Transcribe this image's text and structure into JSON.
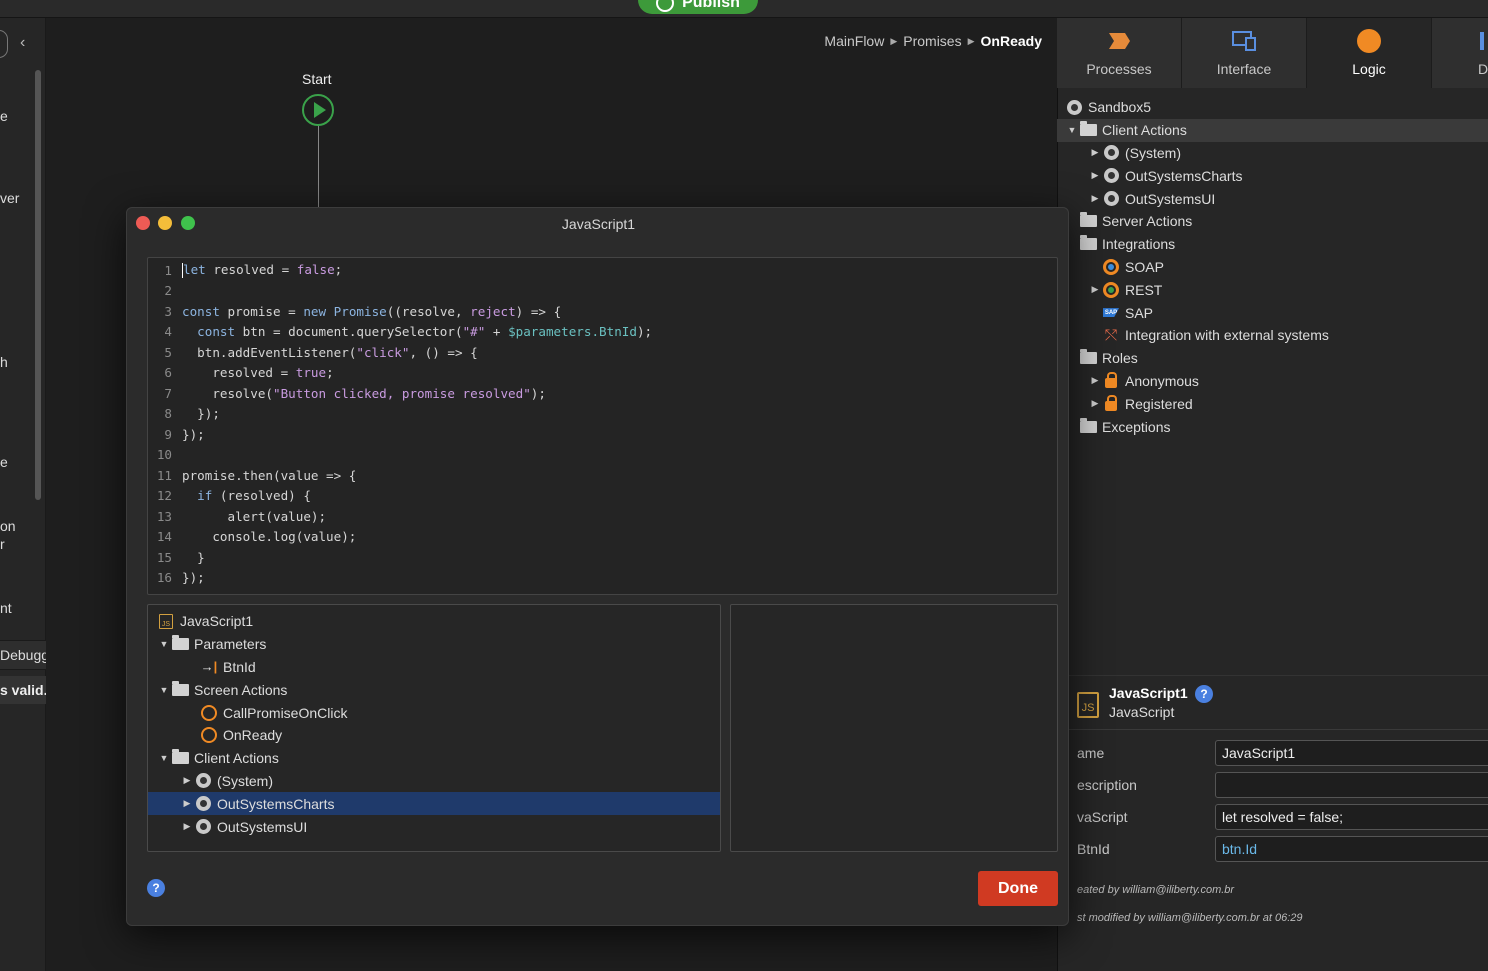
{
  "toolbar": {
    "publish_label": "Publish"
  },
  "left_panel": {
    "fragments": [
      "e",
      "ver",
      "h",
      "e",
      "on",
      "r",
      "nt"
    ],
    "debugger_label": "Debugger",
    "valid_text": "s valid."
  },
  "canvas": {
    "breadcrumb": [
      "MainFlow",
      "Promises",
      "OnReady"
    ],
    "start_label": "Start"
  },
  "right_panel": {
    "tabs": [
      {
        "label": "Processes",
        "icon": "processes-icon"
      },
      {
        "label": "Interface",
        "icon": "interface-icon"
      },
      {
        "label": "Logic",
        "icon": "logic-icon"
      },
      {
        "label": "D",
        "icon": "data-icon"
      }
    ],
    "tree": [
      {
        "label": "Sandbox5",
        "icon": "module-icon"
      },
      {
        "label": "Client Actions",
        "icon": "folder-open-icon",
        "caret": "down"
      },
      {
        "label": "(System)",
        "icon": "module-icon",
        "caret": "right"
      },
      {
        "label": "OutSystemsCharts",
        "icon": "module-icon",
        "caret": "right"
      },
      {
        "label": "OutSystemsUI",
        "icon": "module-icon",
        "caret": "right"
      },
      {
        "label": "Server Actions",
        "icon": "folder-icon"
      },
      {
        "label": "Integrations",
        "icon": "folder-open-icon"
      },
      {
        "label": "SOAP",
        "icon": "soap-icon"
      },
      {
        "label": "REST",
        "icon": "rest-icon",
        "caret": "right"
      },
      {
        "label": "SAP",
        "icon": "sap-icon"
      },
      {
        "label": "Integration with external systems",
        "icon": "integration-icon"
      },
      {
        "label": "Roles",
        "icon": "folder-open-icon"
      },
      {
        "label": "Anonymous",
        "icon": "lock-icon",
        "caret": "right"
      },
      {
        "label": "Registered",
        "icon": "lock-icon",
        "caret": "right"
      },
      {
        "label": "Exceptions",
        "icon": "folder-icon"
      }
    ],
    "properties": {
      "title": "JavaScript1",
      "subtitle": "JavaScript",
      "js_icon_text": "JS",
      "fields": [
        {
          "label": "ame",
          "value": "JavaScript1"
        },
        {
          "label": "escription",
          "value": ""
        },
        {
          "label": "vaScript",
          "value": "let resolved = false;"
        },
        {
          "label": "BtnId",
          "value": "btn.Id"
        }
      ],
      "created_by": "eated by william@iliberty.com.br",
      "modified_by": "st modified by william@iliberty.com.br at 06:29"
    }
  },
  "modal": {
    "title": "JavaScript1",
    "code_lines": [
      "let resolved = false;",
      "",
      "const promise = new Promise((resolve, reject) => {",
      "  const btn = document.querySelector(\"#\" + $parameters.BtnId);",
      "  btn.addEventListener(\"click\", () => {",
      "    resolved = true;",
      "    resolve(\"Button clicked, promise resolved\");",
      "  });",
      "});",
      "",
      "promise.then(value => {",
      "  if (resolved) {",
      "      alert(value);",
      "    console.log(value);",
      "  }",
      "});"
    ],
    "tree": [
      {
        "label": "JavaScript1",
        "icon": "js-icon",
        "indent": 0
      },
      {
        "label": "Parameters",
        "icon": "folder-open-icon",
        "indent": 0,
        "caret": "down"
      },
      {
        "label": "BtnId",
        "icon": "input-parameter-icon",
        "indent": 1
      },
      {
        "label": "Screen Actions",
        "icon": "folder-open-icon",
        "indent": 0,
        "caret": "down"
      },
      {
        "label": "CallPromiseOnClick",
        "icon": "action-icon",
        "indent": 1
      },
      {
        "label": "OnReady",
        "icon": "action-icon",
        "indent": 1
      },
      {
        "label": "Client Actions",
        "icon": "folder-open-icon",
        "indent": 0,
        "caret": "down"
      },
      {
        "label": "(System)",
        "icon": "module-icon",
        "indent": 1,
        "caret": "right"
      },
      {
        "label": "OutSystemsCharts",
        "icon": "module-icon",
        "indent": 1,
        "caret": "right",
        "selected": true
      },
      {
        "label": "OutSystemsUI",
        "icon": "module-icon",
        "indent": 1,
        "caret": "right"
      }
    ],
    "done_label": "Done",
    "help_label": "?"
  },
  "colors": {
    "accent_green": "#3aa24a",
    "done_red": "#d03a22",
    "selection_blue": "#1f3a6b",
    "help_blue": "#4a80e0",
    "lock_orange": "#f08a24"
  }
}
